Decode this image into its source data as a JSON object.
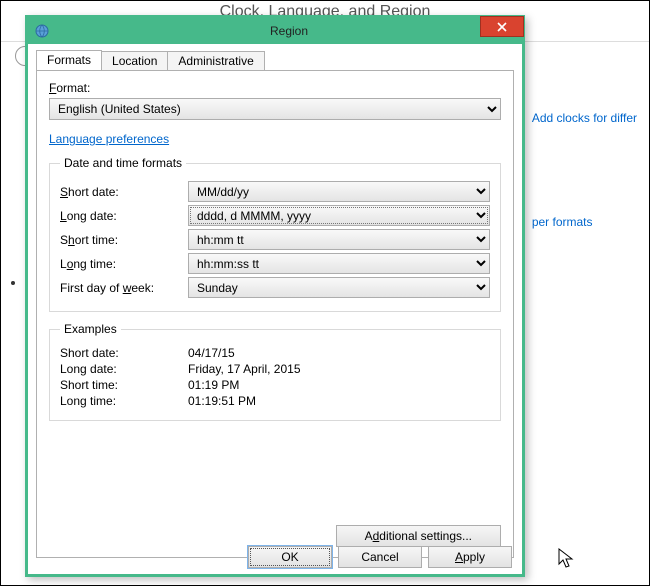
{
  "background": {
    "title": "Clock, Language, and Region",
    "link1": "Add clocks for differ",
    "link2": "per formats"
  },
  "dialog": {
    "title": "Region",
    "close": "×",
    "tabs": {
      "formats": "Formats",
      "location": "Location",
      "administrative": "Administrative"
    },
    "format_label": "Format:",
    "format_value": "English (United States)",
    "lang_prefs": "Language preferences",
    "groupbox1": "Date and time formats",
    "rows": {
      "short_date_label": "Short date:",
      "short_date_value": "MM/dd/yy",
      "long_date_label": "Long date:",
      "long_date_value": "dddd, d MMMM, yyyy",
      "short_time_label": "Short time:",
      "short_time_value": "hh:mm tt",
      "long_time_label": "Long time:",
      "long_time_value": "hh:mm:ss tt",
      "first_day_label": "First day of week:",
      "first_day_value": "Sunday"
    },
    "groupbox2": "Examples",
    "examples": {
      "short_date_label": "Short date:",
      "short_date_value": "04/17/15",
      "long_date_label": "Long date:",
      "long_date_value": "Friday, 17 April, 2015",
      "short_time_label": "Short time:",
      "short_time_value": "01:19 PM",
      "long_time_label": "Long time:",
      "long_time_value": "01:19:51 PM"
    },
    "additional": "Additional settings...",
    "ok": "OK",
    "cancel": "Cancel",
    "apply": "Apply"
  }
}
